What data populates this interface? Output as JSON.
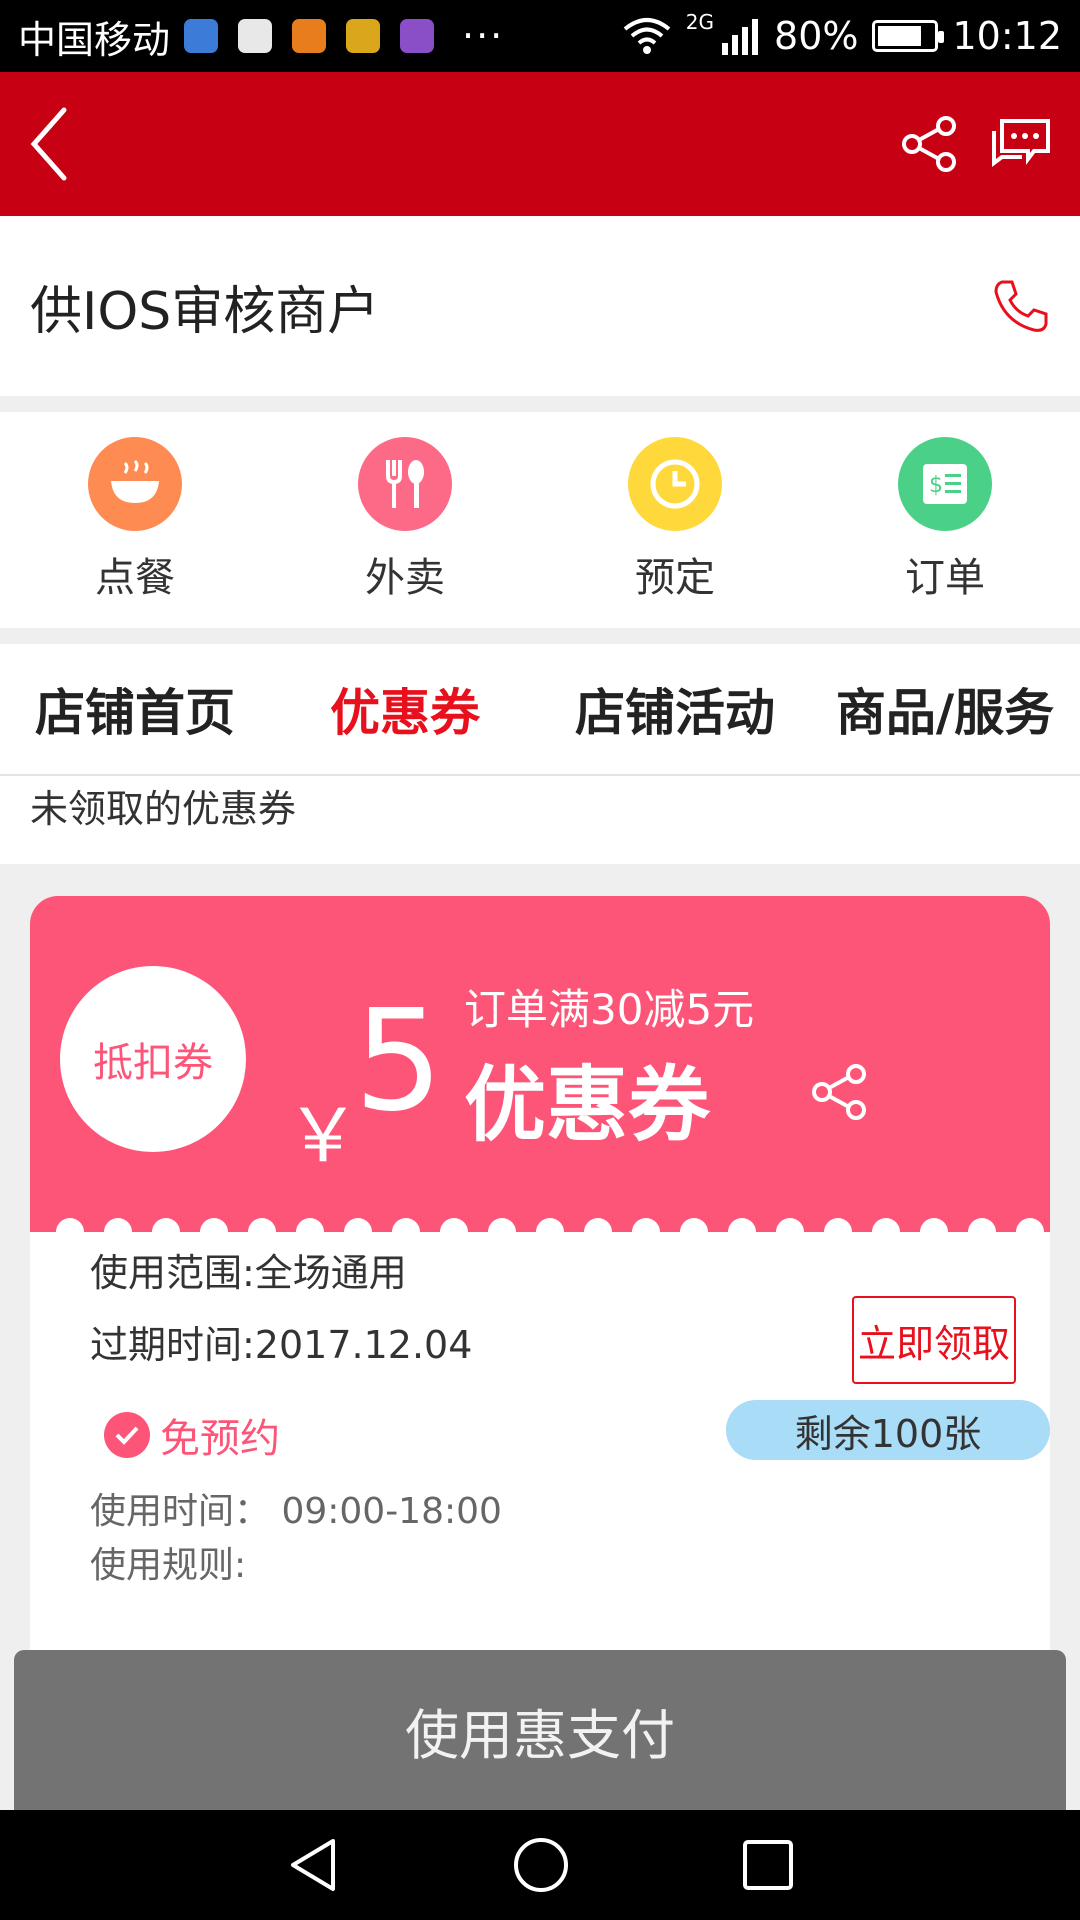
{
  "status_bar": {
    "carrier": "中国移动",
    "more": "···",
    "network": "2G",
    "battery": "80%",
    "time": "10:12",
    "battery_level": 0.8
  },
  "header": {
    "back_icon": "chevron-left-icon",
    "share_icon": "share-icon",
    "message_icon": "chat-icon"
  },
  "merchant": {
    "name": "供IOS审核商户",
    "phone_icon": "phone-icon"
  },
  "quick_actions": [
    {
      "label": "点餐",
      "icon": "bowl-icon",
      "color": "#fe8c52"
    },
    {
      "label": "外卖",
      "icon": "fork-spoon-icon",
      "color": "#fd6a87"
    },
    {
      "label": "预定",
      "icon": "clock-icon",
      "color": "#ffd83b"
    },
    {
      "label": "订单",
      "icon": "receipt-icon",
      "color": "#4bd187"
    }
  ],
  "tabs": [
    {
      "label": "店铺首页",
      "active": false
    },
    {
      "label": "优惠券",
      "active": true
    },
    {
      "label": "店铺活动",
      "active": false
    },
    {
      "label": "商品/服务",
      "active": false
    }
  ],
  "section_title": "未领取的优惠券",
  "coupon": {
    "type_badge": "抵扣券",
    "currency": "￥",
    "amount": "5",
    "condition": "订单满30减5元",
    "title": "优惠券",
    "scope": "使用范围:全场通用",
    "expiry": "过期时间:2017.12.04",
    "claim_label": "立即领取",
    "no_reservation": "免预约",
    "remaining": "剩余100张",
    "use_time": "使用时间：  09:00-18:00",
    "rules": "使用规则:",
    "color": "#fd5578"
  },
  "pay_button": "使用惠支付",
  "colors": {
    "brand_red": "#c70013",
    "active_tab": "#e8101c"
  }
}
